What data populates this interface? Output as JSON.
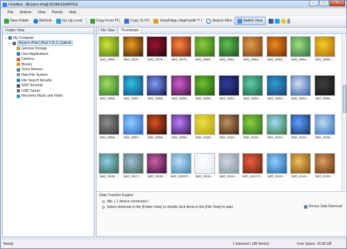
{
  "window": {
    "title": "i-FunBox - [Bryan's iPad]:/DCIM/100APPLE"
  },
  "menu": [
    "File",
    "Actions",
    "View",
    "Panels",
    "Help"
  ],
  "toolbar": {
    "new_folder": "New Folder",
    "refresh": "Refresh",
    "go_up": "Go Up Level",
    "copy_from_pc": "Copy From PC",
    "copy_to_pc": "Copy To PC",
    "install_app": "Install App | AppFactile™ |",
    "search_files": "Search Files",
    "switch_view": "Switch View"
  },
  "folder_view": {
    "heading": "Folder View",
    "items": [
      {
        "label": "My Computer",
        "level": 0
      },
      {
        "label": "Bryan's iPad | iPad 2 (5.1) (Jailed)",
        "level": 1
      },
      {
        "label": "General Storage",
        "level": 2
      },
      {
        "label": "User Applications",
        "level": 2
      },
      {
        "label": "Camera",
        "level": 2
      },
      {
        "label": "iBooks",
        "level": 2
      },
      {
        "label": "Voice Memos",
        "level": 2
      },
      {
        "label": "Raw File System",
        "level": 2
      },
      {
        "label": "File Search Results",
        "level": 2
      },
      {
        "label": "SSH Terminal",
        "level": 2
      },
      {
        "label": "USB Tunnel",
        "level": 2
      },
      {
        "label": "Recovery Music and Video",
        "level": 2
      }
    ]
  },
  "tabs": [
    "File View",
    "Thumbnails"
  ],
  "thumbnails": [
    {
      "cap": "IMG_0086....",
      "c1": "#d8e23a",
      "c2": "#3e7a12"
    },
    {
      "cap": "IMG_0037....",
      "c1": "#f0a020",
      "c2": "#3a1a05"
    },
    {
      "cap": "IMG_0078....",
      "c1": "#a01030",
      "c2": "#1a0a10"
    },
    {
      "cap": "IMG_0079....",
      "c1": "#ff8a40",
      "c2": "#6a1a10"
    },
    {
      "cap": "IMG_0080....",
      "c1": "#8bd040",
      "c2": "#2c6a10"
    },
    {
      "cap": "IMG_0081....",
      "c1": "#60c050",
      "c2": "#1a4a20"
    },
    {
      "cap": "IMG_0082....",
      "c1": "#e0a050",
      "c2": "#7a3a10"
    },
    {
      "cap": "IMG_0083....",
      "c1": "#f08a20",
      "c2": "#6a2a05"
    },
    {
      "cap": "IMG_0084....",
      "c1": "#a0e080",
      "c2": "#2a7040"
    },
    {
      "cap": "IMG_0085....",
      "c1": "#f0d020",
      "c2": "#b06010"
    },
    {
      "cap": "IMG_0086....",
      "c1": "#a0e060",
      "c2": "#30702a"
    },
    {
      "cap": "IMG_0087....",
      "c1": "#30c0e0",
      "c2": "#104a7a"
    },
    {
      "cap": "IMG_0088....",
      "c1": "#80a0ff",
      "c2": "#101040"
    },
    {
      "cap": "IMG_0089....",
      "c1": "#d060d0",
      "c2": "#3a103a"
    },
    {
      "cap": "IMG_0090....",
      "c1": "#70c030",
      "c2": "#1a5a10"
    },
    {
      "cap": "IMG_0091....",
      "c1": "#3040a0",
      "c2": "#101030"
    },
    {
      "cap": "IMG_0092....",
      "c1": "#60d0a0",
      "c2": "#1a5a4a"
    },
    {
      "cap": "IMG_0093....",
      "c1": "#30a0d0",
      "c2": "#1a3a6a"
    },
    {
      "cap": "IMG_0094....",
      "c1": "#d0e0f0",
      "c2": "#2a5aa0"
    },
    {
      "cap": "IMG_0095....",
      "c1": "#404040",
      "c2": "#101010"
    },
    {
      "cap": "IMG_0096....",
      "c1": "#909090",
      "c2": "#303030"
    },
    {
      "cap": "IMG_0097....",
      "c1": "#90d0ff",
      "c2": "#2a60c0"
    },
    {
      "cap": "IMG_0098....",
      "c1": "#e05020",
      "c2": "#2a0a0a"
    },
    {
      "cap": "IMG_0099....",
      "c1": "#c080ff",
      "c2": "#30104a"
    },
    {
      "cap": "IMG_0100....",
      "c1": "#f0e040",
      "c2": "#b0a010"
    },
    {
      "cap": "IMG_0101....",
      "c1": "#c09060",
      "c2": "#3a2010"
    },
    {
      "cap": "IMG_0102....",
      "c1": "#8bd040",
      "c2": "#2a6a20"
    },
    {
      "cap": "IMG_0103....",
      "c1": "#a0e0ff",
      "c2": "#307030"
    },
    {
      "cap": "IMG_0104....",
      "c1": "#60a0ff",
      "c2": "#103060"
    },
    {
      "cap": "IMG_0105....",
      "c1": "#c0d8f0",
      "c2": "#3070c0"
    },
    {
      "cap": "IMG_0106....",
      "c1": "#90d0f0",
      "c2": "#306040"
    },
    {
      "cap": "IMG_0107....",
      "c1": "#a0c0e0",
      "c2": "#40604a"
    },
    {
      "cap": "IMG_0108....",
      "c1": "#d060a0",
      "c2": "#301040"
    },
    {
      "cap": "IMG_0109.P....",
      "c1": "#c0e0ff",
      "c2": "#3a80a0"
    },
    {
      "cap": "IMG_0115....",
      "c1": "#ffffff",
      "c2": "#e0e8f0"
    },
    {
      "cap": "IMG_0116....",
      "c1": "#d0d8e0",
      "c2": "#8090a0"
    },
    {
      "cap": "IMG_0117.P....",
      "c1": "#f06040",
      "c2": "#602010"
    },
    {
      "cap": "IMG_0118....",
      "c1": "#90d0ff",
      "c2": "#2060a0"
    },
    {
      "cap": "IMG_0119....",
      "c1": "#f0c060",
      "c2": "#7a4a10"
    },
    {
      "cap": "IMG_0120....",
      "c1": "#e0a060",
      "c2": "#603010"
    }
  ],
  "engine": {
    "title": "Data Transfer Engine",
    "status": "Idle. ( 1 device connected )",
    "hint": "Select shortcuts in the [Folder View] or double-click items in the [File View] to start.",
    "safe_removal": "Device Safe Removal"
  },
  "statusbar": {
    "left": "Ready",
    "mid": "1 Selected / 186 Item(s)",
    "right": "Free Space: 15.00 GB"
  }
}
